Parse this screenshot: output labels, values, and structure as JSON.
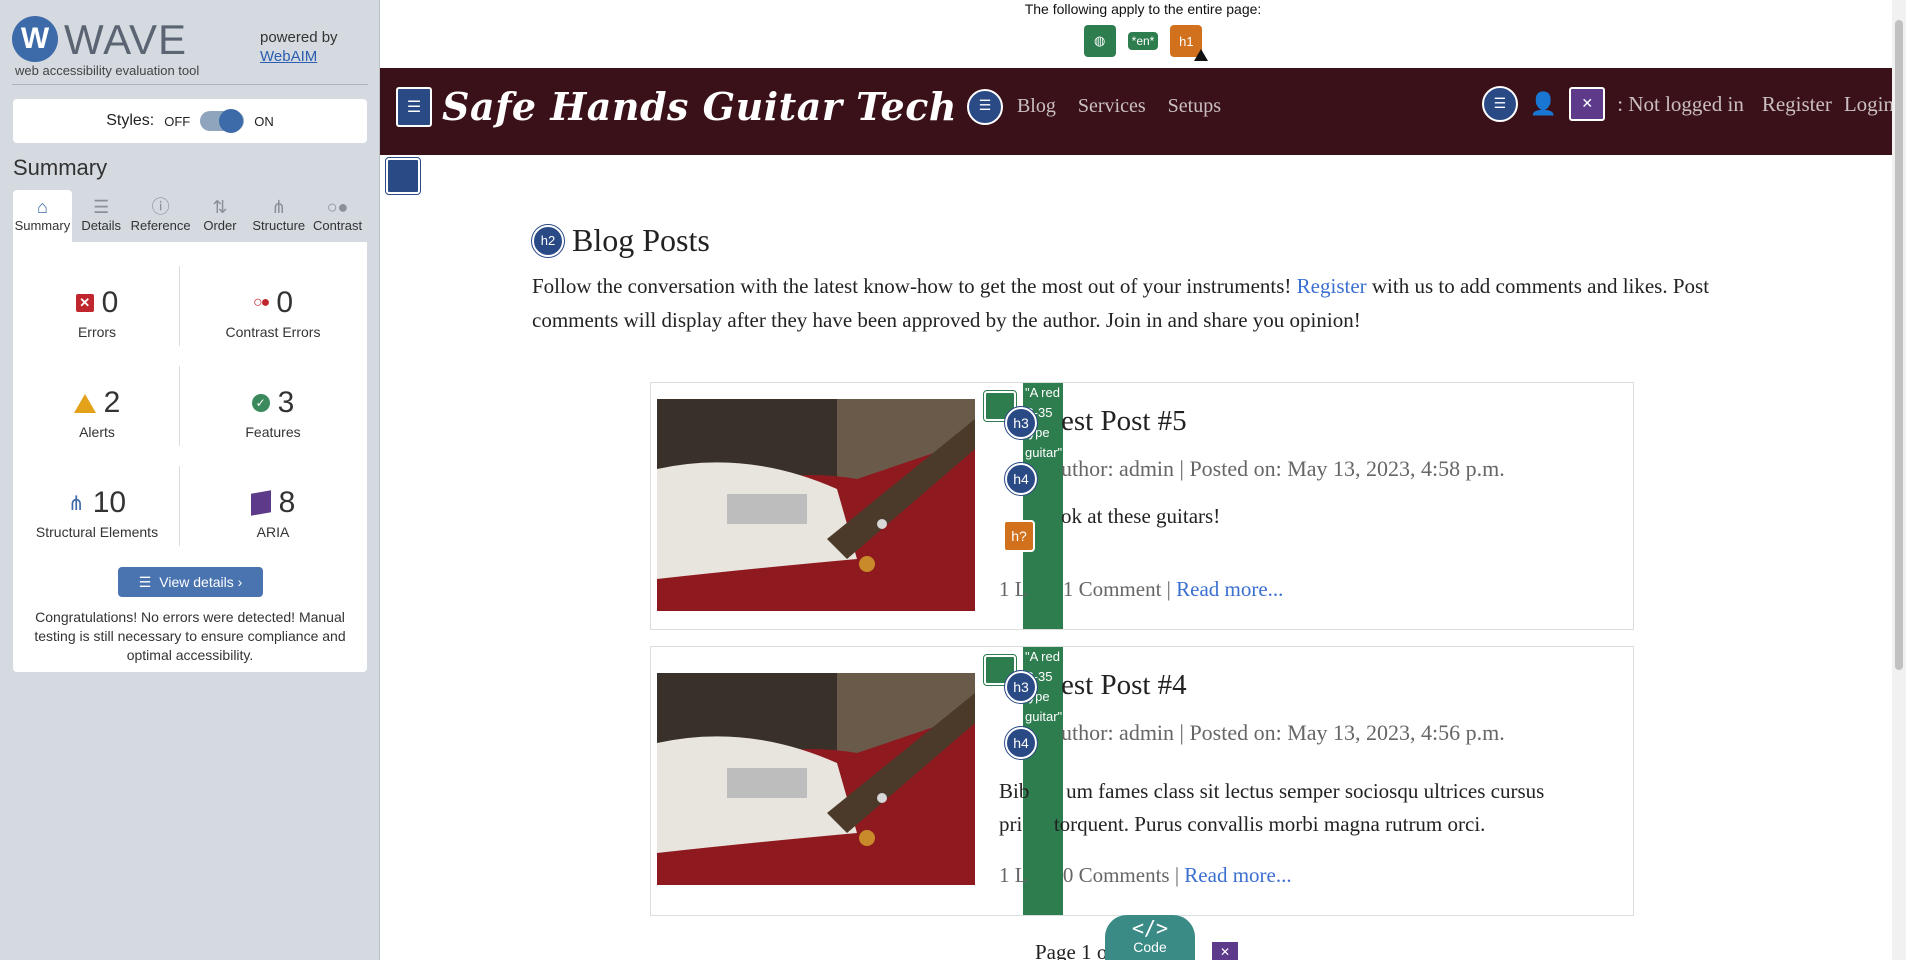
{
  "wave": {
    "title": "WAVE",
    "subtitle": "web accessibility evaluation tool",
    "powered_by": "powered by",
    "powered_link": "WebAIM",
    "styles_label": "Styles:",
    "styles_off": "OFF",
    "styles_on": "ON",
    "summary_heading": "Summary",
    "tabs": [
      {
        "label": "Summary",
        "icon": "home-icon"
      },
      {
        "label": "Details",
        "icon": "list-icon"
      },
      {
        "label": "Reference",
        "icon": "info-icon"
      },
      {
        "label": "Order",
        "icon": "order-icon"
      },
      {
        "label": "Structure",
        "icon": "structure-icon"
      },
      {
        "label": "Contrast",
        "icon": "contrast-icon"
      }
    ],
    "stats": {
      "errors": {
        "value": "0",
        "label": "Errors"
      },
      "contrast_errors": {
        "value": "0",
        "label": "Contrast Errors"
      },
      "alerts": {
        "value": "2",
        "label": "Alerts"
      },
      "features": {
        "value": "3",
        "label": "Features"
      },
      "structural": {
        "value": "10",
        "label": "Structural Elements"
      },
      "aria": {
        "value": "8",
        "label": "ARIA"
      }
    },
    "view_details": "View details ›",
    "congrats": "Congratulations! No errors were detected! Manual testing is still necessary to ensure compliance and optimal accessibility."
  },
  "page": {
    "apply_text": "The following apply to the entire page:",
    "apply_icons": {
      "lang": "language-icon",
      "en": "*en*",
      "h1": "h1"
    },
    "site_title": "Safe Hands Guitar Tech",
    "nav": [
      "Blog",
      "Services",
      "Setups"
    ],
    "not_logged": ": Not logged in",
    "register": "Register",
    "login": "Login",
    "heading_badge": "h2",
    "heading": "Blog Posts",
    "intro_before": "Follow the conversation with the latest know-how to get the most out of your instruments! ",
    "intro_link": "Register",
    "intro_after": " with us to add comments and likes. Post comments will display after they have been approved by the author. Join in and share you opinion!",
    "posts": [
      {
        "title": "est Post #5",
        "meta": "uthor: admin | Posted on: May 13, 2023, 4:58 p.m.",
        "excerpt": "ok at these guitars!",
        "likes": "1 L",
        "comments": "1 Comment |",
        "read_more": "Read more...",
        "alt_text": "\"A red S-35 type guitar\""
      },
      {
        "title": "est Post #4",
        "meta": "uthor: admin | Posted on: May 13, 2023, 4:56 p.m.",
        "excerpt_1": "Bib       um fames class sit lectus semper sociosqu ultrices cursus",
        "excerpt_2": "pri      torquent. Purus convallis morbi magna rutrum orci.",
        "likes": "1 L",
        "comments": "0 Comments |",
        "read_more": "Read more...",
        "alt_text": "\"A red S-35 type guitar\""
      }
    ],
    "badges": {
      "h3": "h3",
      "h4": "h4",
      "hq": "h?"
    },
    "code_label": "Code",
    "pager": "Page 1 o"
  },
  "colors": {
    "nav_bg": "#3b1119",
    "wave_blue": "#3d6aa8",
    "feature_green": "#2e7d4f",
    "alert_orange": "#d2711d",
    "aria_purple": "#5d3a8a",
    "link_blue": "#3b6fd0"
  }
}
